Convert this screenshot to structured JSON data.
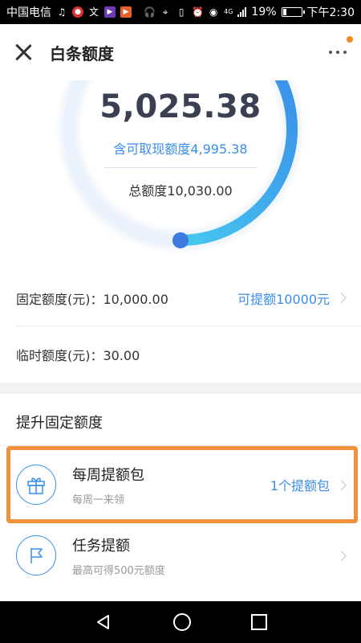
{
  "status_bar": {
    "carrier": "中国电信",
    "battery": "19%",
    "battery_level": 0.19,
    "time": "下午2:30",
    "network": "4G"
  },
  "header": {
    "title": "白条额度"
  },
  "gauge": {
    "available_amount": "5,025.38",
    "cash_available": "含可取现额度4,995.38",
    "total_limit": "总额度10,030.00",
    "usage_fraction": 0.5,
    "colors": {
      "track": "#eaf2fb",
      "gradient_start": "#47c8ef",
      "gradient_end": "#3a8ee8",
      "knob": "#3d7be0"
    }
  },
  "limits": {
    "fixed_label": "固定额度(元)：10,000.00",
    "fixed_link": "可提额10000元",
    "temp_label": "临时额度(元)：30.00"
  },
  "raise": {
    "title": "提升固定额度",
    "items": [
      {
        "title": "每周提额包",
        "subtitle": "每周一来领",
        "right": "1个提额包",
        "icon": "gift-icon"
      },
      {
        "title": "任务提额",
        "subtitle": "最高可得500元额度",
        "right": "",
        "icon": "flag-icon"
      }
    ]
  },
  "colors": {
    "accent": "#3a8ee8",
    "highlight": "#f0923c",
    "notification_dot": "#f08a24"
  }
}
